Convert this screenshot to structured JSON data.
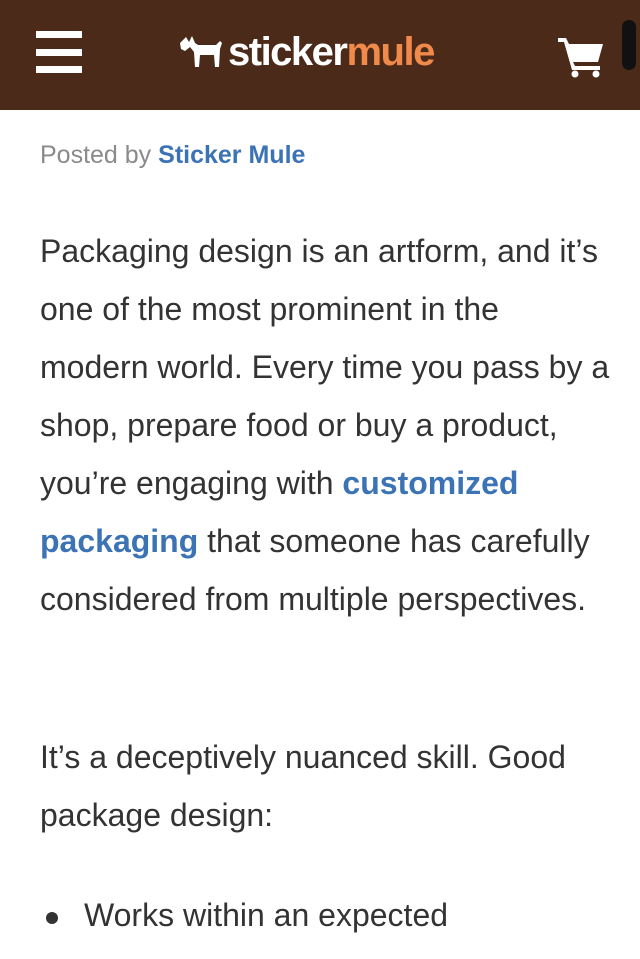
{
  "header": {
    "logo": {
      "part1": "sticker",
      "part2": "mule"
    },
    "colors": {
      "background": "#4b2a1a",
      "accent": "#f08a4b"
    },
    "icons": {
      "menu": "hamburger-icon",
      "cart": "cart-icon",
      "logo": "mule-icon"
    }
  },
  "post": {
    "posted_by_prefix": "Posted by",
    "author": "Sticker Mule",
    "link_color": "#3b73b5"
  },
  "content": {
    "p1_before": "Packaging design is an artform, and it’s one of the most prominent in the modern world. Every time you pass by a shop, prepare food or buy a product, you’re engaging with ",
    "p1_link": "customized packaging",
    "p1_after": " that someone has carefully considered from multiple perspectives.",
    "p2": "It’s a deceptively nuanced skill. Good package design:",
    "bullets": [
      "Works within an expected"
    ]
  }
}
